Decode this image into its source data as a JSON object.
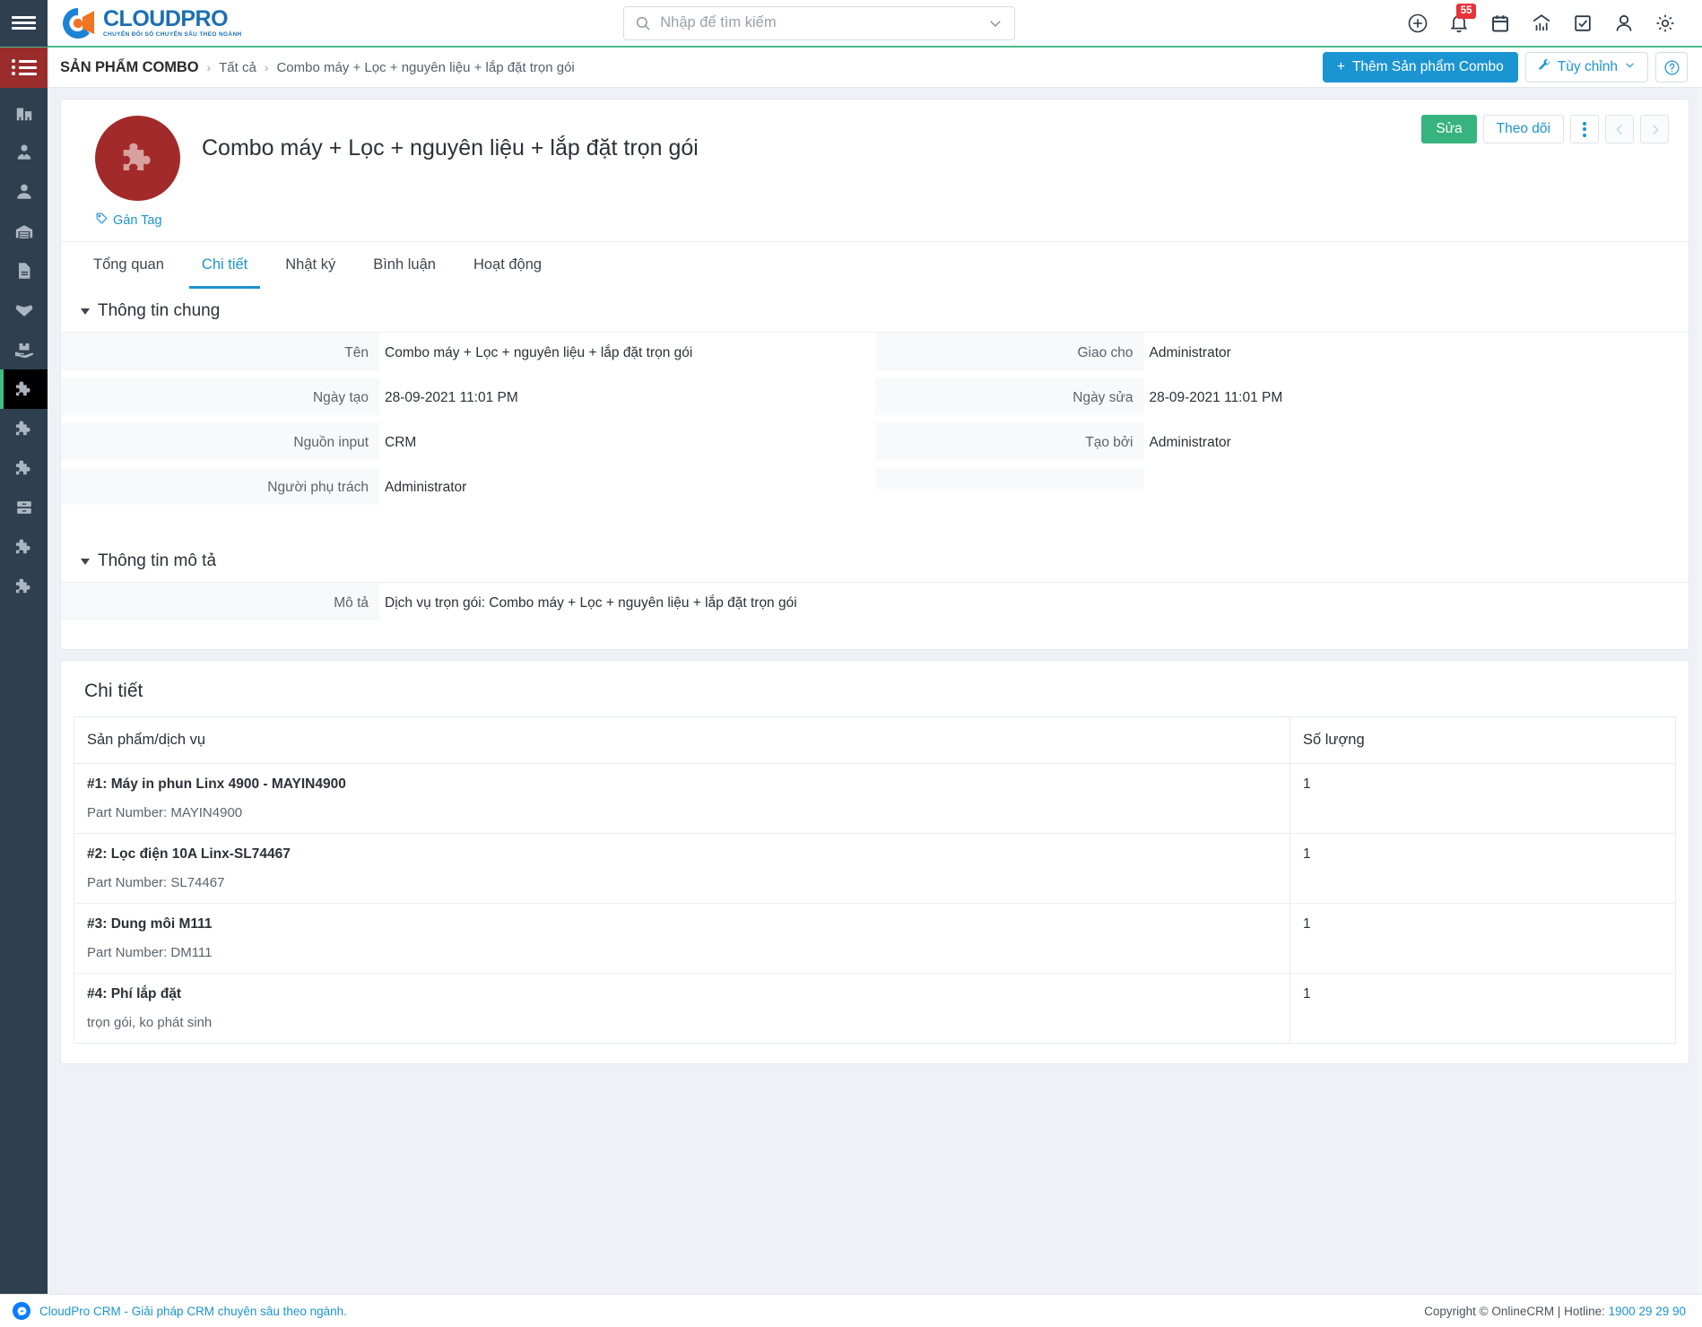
{
  "brand": {
    "name": "CLOUDPRO",
    "tagline": "CHUYỂN ĐỔI SỐ CHUYÊN SÂU THEO NGÀNH",
    "blue": "#1b6fb5",
    "orange": "#f07421",
    "accent_green": "#49b98a"
  },
  "search": {
    "placeholder": "Nhập để tìm kiếm",
    "value": ""
  },
  "topbar": {
    "icons": [
      {
        "name": "add-circle-icon",
        "label": "Thêm"
      },
      {
        "name": "bell-icon",
        "label": "Thông báo",
        "badge": "55"
      },
      {
        "name": "calendar-icon",
        "label": "Lịch"
      },
      {
        "name": "chart-icon",
        "label": "Báo cáo"
      },
      {
        "name": "checkbox-icon",
        "label": "Công việc"
      },
      {
        "name": "user-icon",
        "label": "Tài khoản"
      },
      {
        "name": "gear-icon",
        "label": "Cài đặt"
      }
    ]
  },
  "breadcrumb": {
    "root": "SẢN PHẨM COMBO",
    "separator": "›",
    "parent": "Tất cả",
    "current": "Combo máy + Lọc + nguyên liệu + lắp đặt trọn gói",
    "add_button": "Thêm Sản phẩm Combo",
    "add_button_plus": "+",
    "customize_button": "Tùy chỉnh",
    "help_button": "?"
  },
  "sidebar": {
    "items": [
      {
        "name": "sidebar-item-company",
        "icon": "building-icon",
        "active": false
      },
      {
        "name": "sidebar-item-contact-person",
        "icon": "user-tie-icon",
        "active": false
      },
      {
        "name": "sidebar-item-lead",
        "icon": "person-icon",
        "active": false
      },
      {
        "name": "sidebar-item-warehouse",
        "icon": "warehouse-icon",
        "active": false
      },
      {
        "name": "sidebar-item-document",
        "icon": "document-icon",
        "active": false
      },
      {
        "name": "sidebar-item-product",
        "icon": "box-open-icon",
        "active": false
      },
      {
        "name": "sidebar-item-delivery",
        "icon": "box-hand-icon",
        "active": false
      },
      {
        "name": "sidebar-item-combo-product",
        "icon": "puzzle-icon",
        "active": true
      },
      {
        "name": "sidebar-item-module-1",
        "icon": "puzzle-icon",
        "active": false
      },
      {
        "name": "sidebar-item-module-2",
        "icon": "puzzle-icon",
        "active": false
      },
      {
        "name": "sidebar-item-archive",
        "icon": "archive-icon",
        "active": false
      },
      {
        "name": "sidebar-item-module-3",
        "icon": "puzzle-icon",
        "active": false
      },
      {
        "name": "sidebar-item-module-4",
        "icon": "puzzle-icon",
        "active": false
      }
    ]
  },
  "record": {
    "title": "Combo máy + Lọc + nguyên liệu + lắp đặt trọn gói",
    "avatar_icon": "puzzle-icon",
    "avatar_color": "#a32a2a",
    "tag_link": "Gán Tag",
    "actions": {
      "edit": "Sửa",
      "follow": "Theo dõi",
      "more": "⋮",
      "prev": "‹",
      "next": "›"
    }
  },
  "tabs": [
    {
      "label": "Tổng quan",
      "active": false
    },
    {
      "label": "Chi tiết",
      "active": true
    },
    {
      "label": "Nhật ký",
      "active": false
    },
    {
      "label": "Bình luận",
      "active": false
    },
    {
      "label": "Hoạt động",
      "active": false
    }
  ],
  "sections": {
    "general": {
      "title": "Thông tin chung",
      "left_fields": [
        {
          "label": "Tên",
          "value": "Combo máy + Lọc + nguyên liệu + lắp đặt trọn gói"
        },
        {
          "label": "Ngày tạo",
          "value": "28-09-2021 11:01 PM"
        },
        {
          "label": "Nguồn input",
          "value": "CRM"
        },
        {
          "label": "Người phụ trách",
          "value": "Administrator"
        }
      ],
      "right_fields": [
        {
          "label": "Giao cho",
          "value": "Administrator"
        },
        {
          "label": "Ngày sửa",
          "value": "28-09-2021 11:01 PM"
        },
        {
          "label": "Tạo bởi",
          "value": "Administrator"
        }
      ]
    },
    "description": {
      "title": "Thông tin mô tả",
      "fields": [
        {
          "label": "Mô tả",
          "value": "Dịch vụ trọn gói: Combo máy + Lọc + nguyên liệu + lắp đặt trọn gói"
        }
      ]
    },
    "detail": {
      "title": "Chi tiết",
      "columns": [
        "Sản phẩm/dịch vụ",
        "Số lượng"
      ],
      "rows": [
        {
          "name": "#1: Máy in phun Linx 4900 - MAYIN4900",
          "sub": "Part Number: MAYIN4900",
          "qty": "1"
        },
        {
          "name": "#2: Lọc điện 10A Linx-SL74467",
          "sub": "Part Number: SL74467",
          "qty": "1"
        },
        {
          "name": "#3: Dung môi M111",
          "sub": "Part Number: DM111",
          "qty": "1"
        },
        {
          "name": "#4: Phí lắp đặt",
          "sub": "trọn gói, ko phát sinh",
          "qty": "1"
        }
      ]
    }
  },
  "footer": {
    "left_text": "CloudPro CRM - Giải pháp CRM chuyên sâu theo ngành.",
    "copyright": "Copyright © OnlineCRM | Hotline: ",
    "hotline": "1900 29 29 90"
  }
}
